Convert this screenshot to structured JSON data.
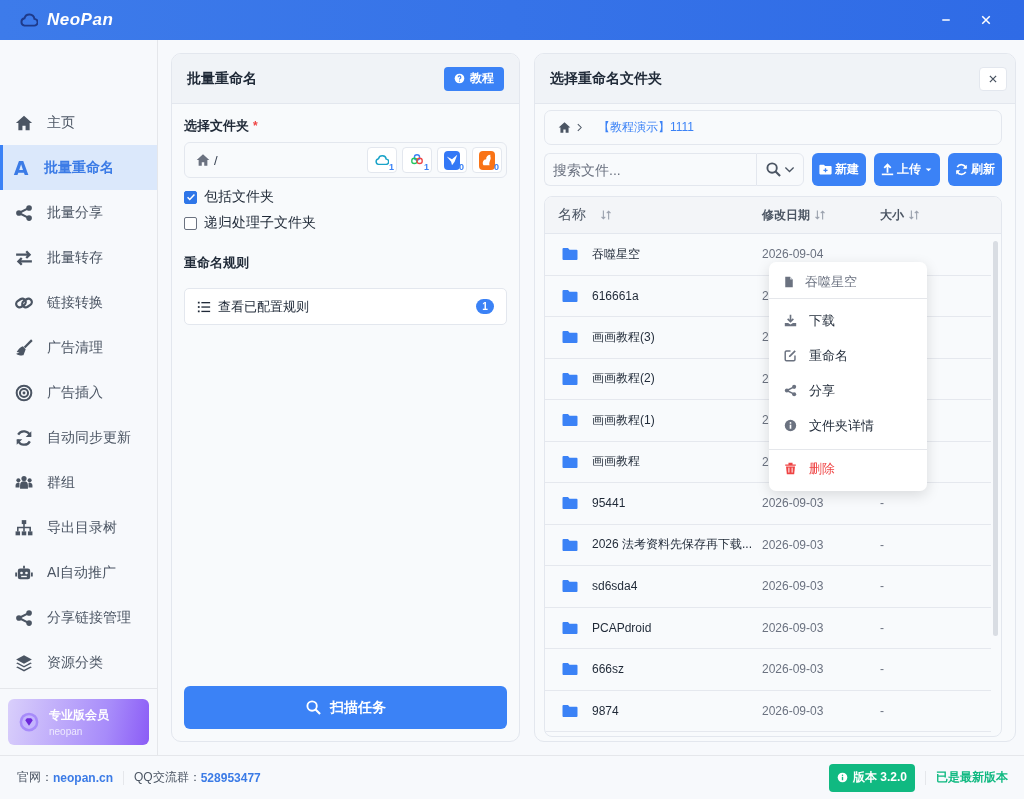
{
  "window": {
    "title": "NeoPan"
  },
  "sidebar": {
    "items": [
      {
        "label": "主页",
        "selected": false
      },
      {
        "label": "批量重命名",
        "selected": true,
        "glyph": "A"
      },
      {
        "label": "批量分享",
        "selected": false
      },
      {
        "label": "批量转存",
        "selected": false
      },
      {
        "label": "链接转换",
        "selected": false
      },
      {
        "label": "广告清理",
        "selected": false
      },
      {
        "label": "广告插入",
        "selected": false
      },
      {
        "label": "自动同步更新",
        "selected": false
      },
      {
        "label": "群组",
        "selected": false
      },
      {
        "label": "导出目录树",
        "selected": false
      },
      {
        "label": "AI自动推广",
        "selected": false
      },
      {
        "label": "分享链接管理",
        "selected": false
      },
      {
        "label": "资源分类",
        "selected": false
      }
    ],
    "pro_card": {
      "title": "专业版会员",
      "subtitle": "neopan"
    }
  },
  "rename_panel": {
    "title": "批量重命名",
    "tutorial_button": "教程",
    "folder_label": "选择文件夹",
    "required_mark": "*",
    "path": "/",
    "drives": [
      {
        "count": "1"
      },
      {
        "count": "1"
      },
      {
        "count": "0"
      },
      {
        "count": "0"
      }
    ],
    "options": [
      {
        "label": "包括文件夹",
        "checked": true
      },
      {
        "label": "递归处理子文件夹",
        "checked": false
      }
    ],
    "rules_label": "重命名规则",
    "rules_button": {
      "label": "查看已配置规则",
      "badge": "1"
    },
    "scan_button": "扫描任务"
  },
  "browser_panel": {
    "title": "选择重命名文件夹",
    "breadcrumb": "【教程演示】1111",
    "search": {
      "placeholder": "搜索文件..."
    },
    "buttons": [
      {
        "label": "新建",
        "kind": "plain"
      },
      {
        "label": "上传",
        "kind": "dropdown"
      },
      {
        "label": "刷新",
        "kind": "plain"
      }
    ],
    "columns": [
      "名称",
      "修改日期",
      "大小"
    ],
    "rows": [
      {
        "name": "吞噬星空",
        "date": "2026-09-04"
      },
      {
        "name": "616661a",
        "date": "2"
      },
      {
        "name": "画画教程(3)",
        "date": "2"
      },
      {
        "name": "画画教程(2)",
        "date": "2"
      },
      {
        "name": "画画教程(1)",
        "date": "2"
      },
      {
        "name": "画画教程",
        "date": "2"
      },
      {
        "name": "95441",
        "date": "2026-09-03",
        "size": "-"
      },
      {
        "name": "2026 法考资料先保存再下载...",
        "date": "2026-09-03",
        "size": "-"
      },
      {
        "name": "sd6sda4",
        "date": "2026-09-03",
        "size": "-"
      },
      {
        "name": "PCAPdroid",
        "date": "2026-09-03",
        "size": "-"
      },
      {
        "name": "666sz",
        "date": "2026-09-03",
        "size": "-"
      },
      {
        "name": "9874",
        "date": "2026-09-03",
        "size": "-"
      }
    ]
  },
  "context_menu": {
    "title": "吞噬星空",
    "items": [
      {
        "label": "下载",
        "kind": "normal"
      },
      {
        "label": "重命名",
        "kind": "normal"
      },
      {
        "label": "分享",
        "kind": "normal"
      },
      {
        "label": "文件夹详情",
        "kind": "normal"
      },
      {
        "label": "删除",
        "kind": "danger"
      }
    ]
  },
  "footer": {
    "site_label": "官网：",
    "site_link": "neopan.cn",
    "qq_label": "QQ交流群：",
    "qq_link": "528953477",
    "version": "版本 3.2.0",
    "status": "已是最新版本"
  }
}
